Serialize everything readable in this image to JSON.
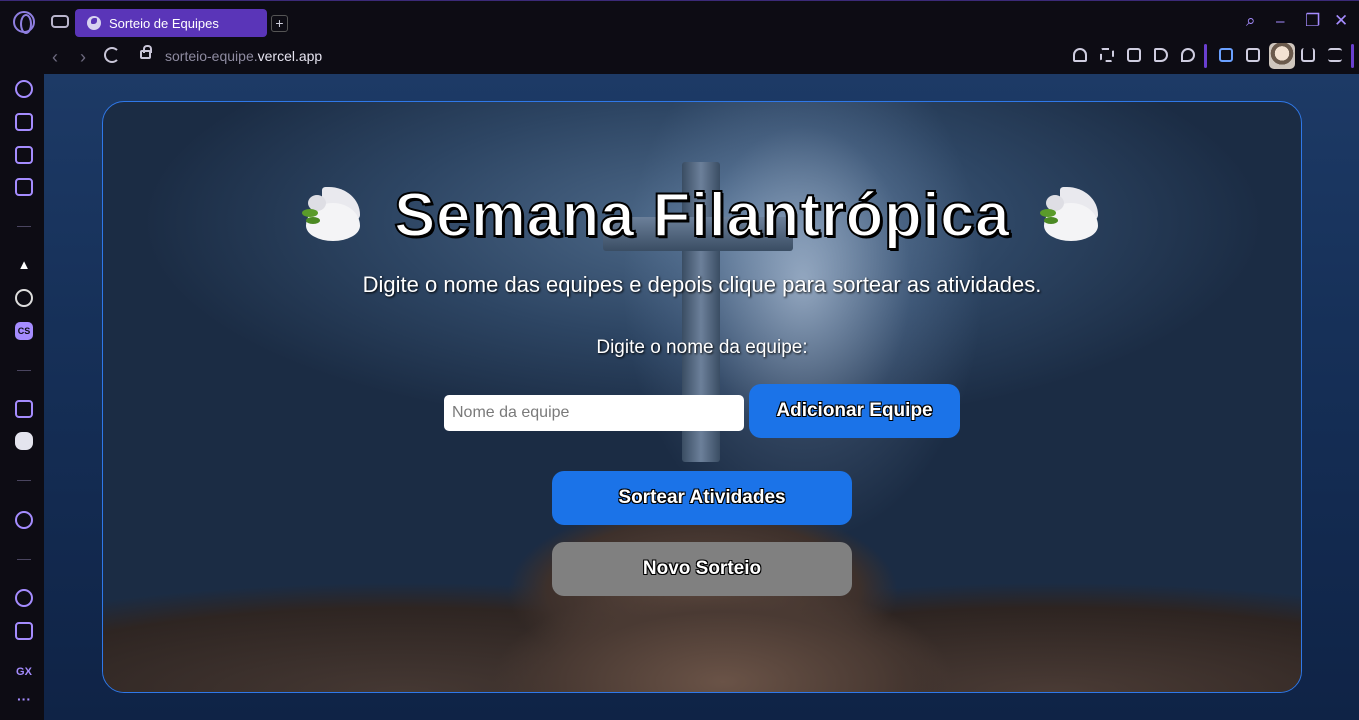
{
  "browser": {
    "tab_title": "Sorteio de Equipes",
    "new_tab_label": "+",
    "url_prefix": "sorteio-equipe.",
    "url_domain": "vercel.app",
    "accent_color": "#5a35b8"
  },
  "sidebar": {
    "items": [
      "speed-dial",
      "ai-icon",
      "wallpaper",
      "messenger",
      "aria",
      "chatgpt",
      "cs",
      "twitch",
      "discord",
      "player",
      "history",
      "extensions"
    ],
    "gx_label": "GX",
    "more_label": "···"
  },
  "page": {
    "title": "Semana Filantrópica",
    "subtitle": "Digite o nome das equipes e depois clique para sortear as atividades.",
    "input_label": "Digite o nome da equipe:",
    "input_placeholder": "Nome da equipe",
    "add_button": "Adicionar Equipe",
    "draw_button": "Sortear Atividades",
    "new_button": "Novo Sorteio",
    "primary_color": "#1b73e8",
    "secondary_color": "#808080"
  }
}
